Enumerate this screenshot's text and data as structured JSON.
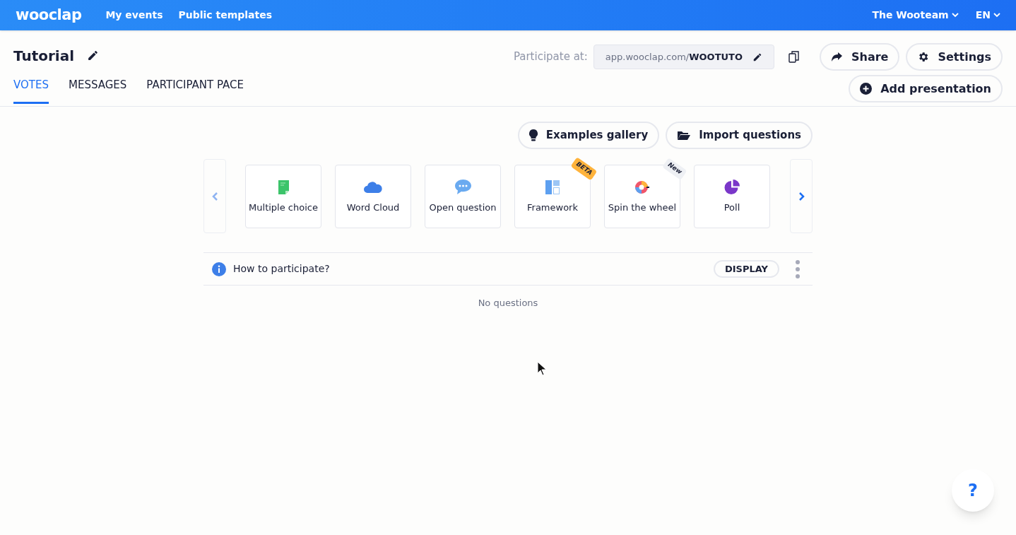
{
  "topbar": {
    "logo": "wooclap",
    "nav": [
      "My events",
      "Public templates"
    ],
    "account": "The Wooteam",
    "language": "EN"
  },
  "event": {
    "title": "Tutorial",
    "participate_label": "Participate at:",
    "url_prefix": "app.wooclap.com/",
    "url_code": "WOOTUTO"
  },
  "actions": [
    "Share",
    "Settings",
    "Add presentation"
  ],
  "tabs": [
    {
      "label": "VOTES",
      "selected": true
    },
    {
      "label": "MESSAGES",
      "selected": false
    },
    {
      "label": "PARTICIPANT PACE",
      "selected": false
    }
  ],
  "toolbar": [
    "Examples gallery",
    "Import questions"
  ],
  "question_types": [
    {
      "kind": "multiple",
      "label": "Multiple choice"
    },
    {
      "kind": "cloud",
      "label": "Word Cloud"
    },
    {
      "kind": "open",
      "label": "Open question"
    },
    {
      "kind": "framework",
      "label": "Framework",
      "badge": "BETA",
      "color": "#ffb33b"
    },
    {
      "kind": "wheel",
      "label": "Spin the wheel",
      "badge": "New",
      "color": "#eef0f4"
    },
    {
      "kind": "poll",
      "label": "Poll"
    }
  ],
  "info_row": {
    "text": "How to participate?",
    "button": "DISPLAY"
  },
  "empty_text": "No questions",
  "help": "?"
}
